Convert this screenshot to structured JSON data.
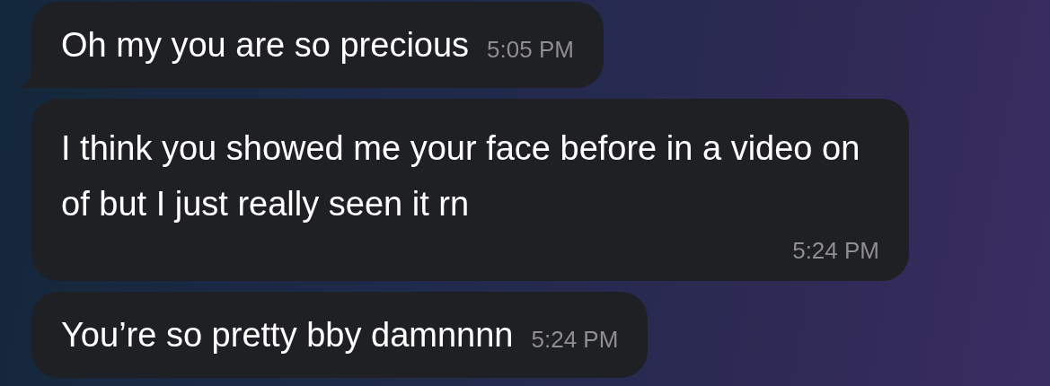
{
  "messages": [
    {
      "kind": "inline",
      "tail": true,
      "text": "Oh my you are so precious",
      "time": "5:05 PM"
    },
    {
      "kind": "block",
      "tail": false,
      "text": "I think you showed me your face before in a video on of but I just really seen it rn",
      "time": "5:24 PM"
    },
    {
      "kind": "inline",
      "tail": false,
      "text": "You’re so pretty bby damnnnn",
      "time": "5:24 PM"
    }
  ]
}
